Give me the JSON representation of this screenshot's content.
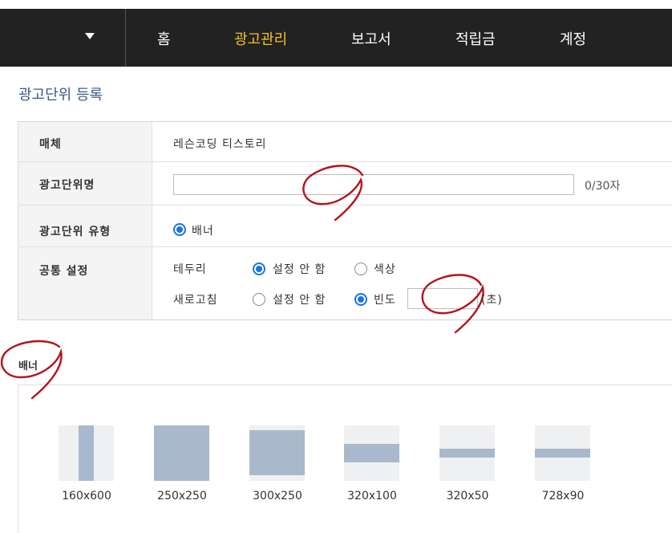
{
  "nav": {
    "items": [
      {
        "label": "홈",
        "active": false
      },
      {
        "label": "광고관리",
        "active": true
      },
      {
        "label": "보고서",
        "active": false
      },
      {
        "label": "적립금",
        "active": false
      },
      {
        "label": "계정",
        "active": false
      }
    ],
    "active_color": "#f3c22b"
  },
  "page": {
    "title": "광고단위 등록"
  },
  "form": {
    "media": {
      "label": "매체",
      "value": "레슨코딩 티스토리"
    },
    "unit_name": {
      "label": "광고단위명",
      "value": "",
      "counter": "0/30자"
    },
    "unit_type": {
      "label": "광고단위 유형",
      "option": "배너",
      "selected": true
    },
    "common": {
      "label": "공통 설정",
      "border": {
        "label": "테두리",
        "options": [
          "설정 안 함",
          "색상"
        ],
        "selected": "설정 안 함"
      },
      "refresh": {
        "label": "새로고침",
        "options": [
          "설정 안 함",
          "빈도"
        ],
        "selected": "빈도",
        "value": "",
        "unit": "(초)"
      }
    }
  },
  "banner": {
    "title": "배너",
    "sizes": [
      "160x600",
      "250x250",
      "300x250",
      "320x100",
      "320x50",
      "728x90"
    ]
  },
  "colors": {
    "accent": "#1a73e8",
    "thumb_fill": "#a9b8cc",
    "annotation": "#b3121b"
  }
}
